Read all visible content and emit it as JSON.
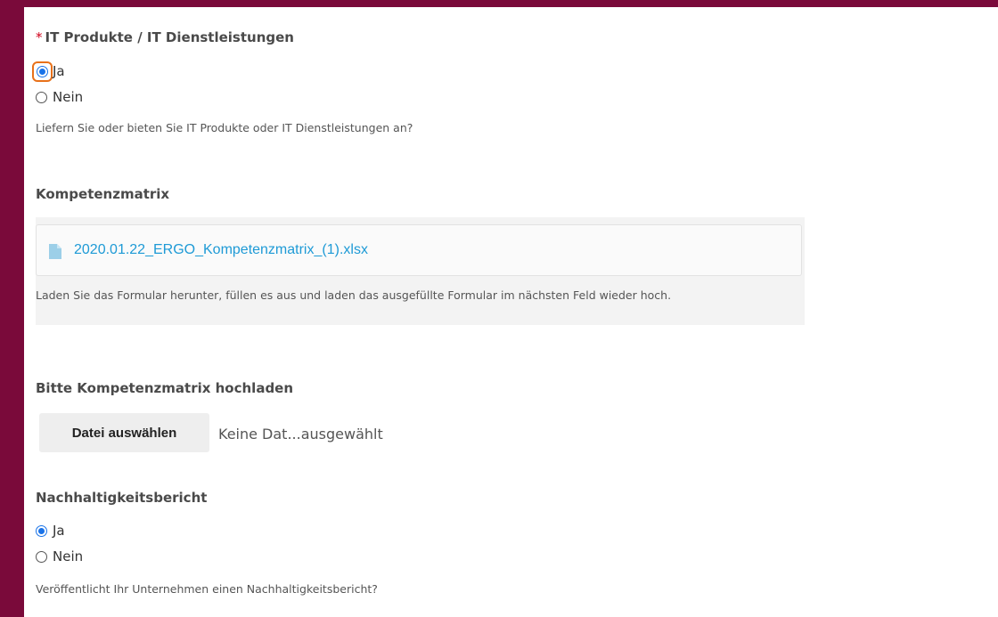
{
  "q1": {
    "required_mark": "*",
    "title": "IT Produkte / IT Dienstleistungen",
    "options": [
      {
        "label": "Ja",
        "selected": true
      },
      {
        "label": "Nein",
        "selected": false
      }
    ],
    "help": "Liefern Sie oder bieten Sie IT Produkte oder IT Dienstleistungen an?"
  },
  "q2": {
    "title": "Kompetenzmatrix",
    "file_icon": "document-icon",
    "file_name": "2020.01.22_ERGO_Kompetenzmatrix_(1).xlsx",
    "help": "Laden Sie das Formular herunter, füllen es aus und laden das ausgefüllte Formular im nächsten Feld wieder hoch."
  },
  "q3": {
    "title": "Bitte Kompetenzmatrix hochladen",
    "button_label": "Datei auswählen",
    "status": "Keine Dat...ausgewählt"
  },
  "q4": {
    "title": "Nachhaltigkeitsbericht",
    "options": [
      {
        "label": "Ja",
        "selected": true
      },
      {
        "label": "Nein",
        "selected": false
      }
    ],
    "help": "Veröffentlicht Ihr Unternehmen einen Nachhaltigkeitsbericht?"
  },
  "colors": {
    "frame": "#7a0a3a",
    "accent": "#1a73e8",
    "link": "#1e9ad6",
    "required": "#d0021b",
    "focus": "#e8711a"
  }
}
